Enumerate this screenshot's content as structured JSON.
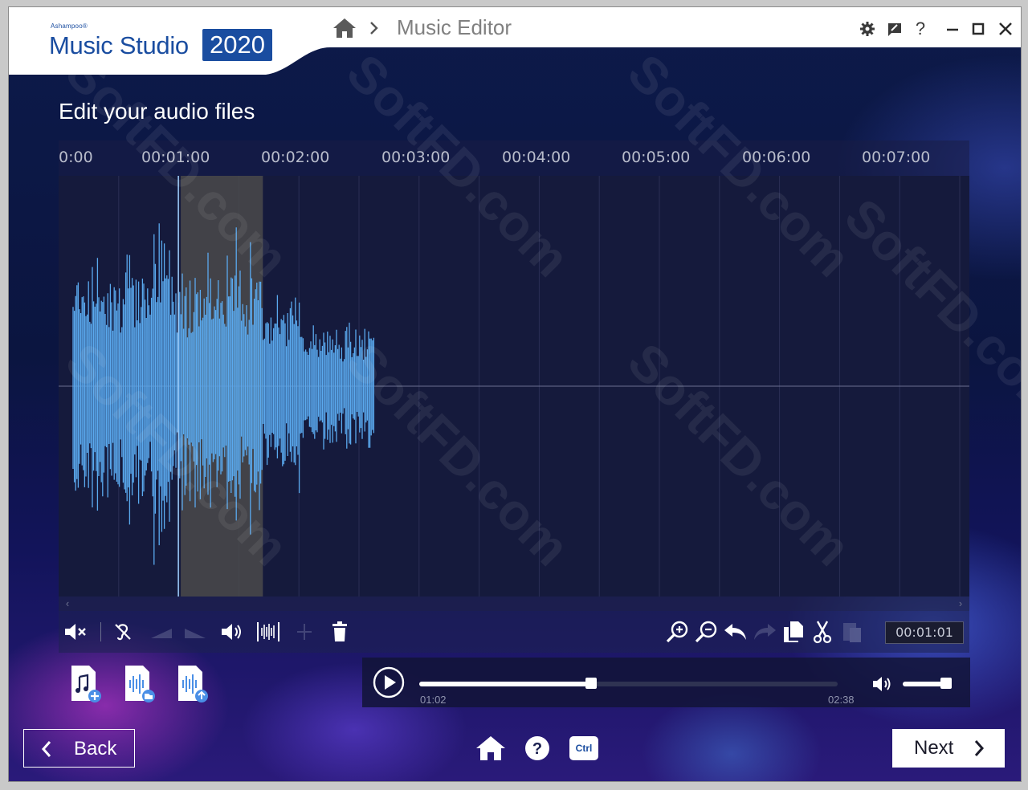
{
  "window": {
    "brand_small": "Ashampoo®",
    "brand_name": "Music Studio",
    "brand_year": "2020",
    "breadcrumb_title": "Music Editor",
    "controls": [
      "settings-icon",
      "feedback-icon",
      "help-icon",
      "minimize-icon",
      "maximize-icon",
      "close-icon"
    ],
    "help_label": "?"
  },
  "page": {
    "heading": "Edit your audio files"
  },
  "timeline": {
    "ticks": [
      "0:00",
      "00:01:00",
      "00:02:00",
      "00:03:00",
      "00:04:00",
      "00:05:00",
      "00:06:00",
      "00:07:00"
    ],
    "audio_duration_seconds": 158,
    "selection_seconds": [
      61,
      102
    ],
    "playhead_seconds": 61
  },
  "toolbar": {
    "time_display": "00:01:01",
    "left_tools": [
      "mute-icon",
      "noise-filter-icon",
      "fade-in-icon",
      "fade-out-icon",
      "volume-icon",
      "normalize-icon",
      "split-icon",
      "delete-icon"
    ],
    "right_tools": [
      "zoom-in-icon",
      "zoom-out-icon",
      "undo-icon",
      "redo-icon",
      "copy-icon",
      "cut-icon",
      "paste-icon"
    ]
  },
  "files": [
    "add-music-file-icon",
    "audio-file-open-icon",
    "audio-file-export-icon"
  ],
  "player": {
    "current_time": "01:02",
    "total_time": "02:38",
    "progress": 0.41,
    "volume": 0.9
  },
  "footer": {
    "back_label": "Back",
    "next_label": "Next",
    "ctrl_label": "Ctrl",
    "help_label": "?"
  },
  "colors": {
    "brand": "#1a4da0",
    "waveform": "#5aa9ee",
    "selection": "#4a4a4a"
  }
}
